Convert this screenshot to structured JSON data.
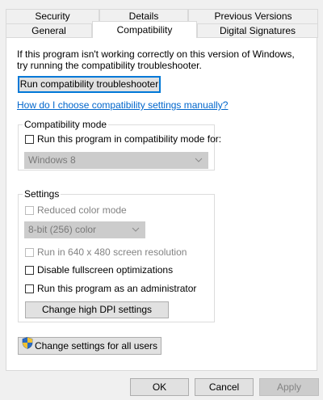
{
  "tabs": {
    "back": [
      "Security",
      "Details",
      "Previous Versions"
    ],
    "front": [
      "General",
      "Compatibility",
      "Digital Signatures"
    ],
    "selected": "Compatibility"
  },
  "intro_text": "If this program isn't working correctly on this version of Windows, try running the compatibility troubleshooter.",
  "troubleshooter_button": "Run compatibility troubleshooter",
  "help_link": "How do I choose compatibility settings manually?",
  "compat_mode": {
    "title": "Compatibility mode",
    "checkbox_label": "Run this program in compatibility mode for:",
    "checked": false,
    "os_select_value": "Windows 8"
  },
  "settings": {
    "title": "Settings",
    "reduced_color_label": "Reduced color mode",
    "color_select_value": "8-bit (256) color",
    "run_640_label": "Run in 640 x 480 screen resolution",
    "disable_fullscreen_label": "Disable fullscreen optimizations",
    "run_as_admin_label": "Run this program as an administrator",
    "high_dpi_button": "Change high DPI settings"
  },
  "all_users_button": "Change settings for all users",
  "footer": {
    "ok": "OK",
    "cancel": "Cancel",
    "apply": "Apply"
  },
  "colors": {
    "accent": "#0078d7",
    "link": "#0066cc"
  }
}
